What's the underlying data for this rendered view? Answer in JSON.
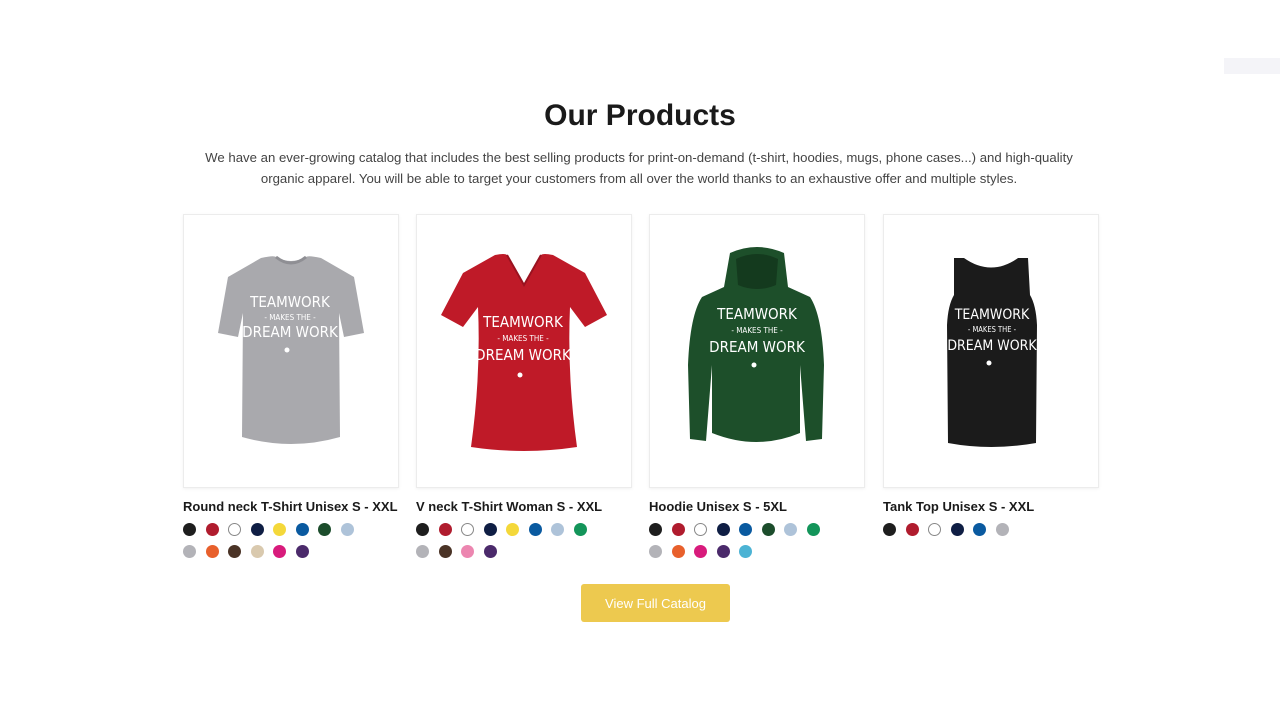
{
  "section": {
    "title": "Our Products",
    "description": "We have an ever-growing catalog that includes the best selling products for print-on-demand (t-shirt, hoodies, mugs, phone cases...) and high-quality organic apparel. You will be able to target your customers from all over the world thanks to an exhaustive offer and multiple styles."
  },
  "print_text": {
    "line1": "TEAMWORK",
    "line2": "- MAKES THE -",
    "line3": "DREAM WORK"
  },
  "products": [
    {
      "name": "Round neck T-Shirt Unisex S - XXL",
      "garment": "tshirt-icon",
      "garment_color": "#a9a9ad",
      "swatches": [
        "#1e1e1e",
        "#b01c2e",
        "#ffffff",
        "#0f1e44",
        "#f4d83a",
        "#0a5aa0",
        "#1c4d2c",
        "#aec3d9",
        "#b3b3b8",
        "#e8602c",
        "#4a3326",
        "#d9c9ae",
        "#d81b7c",
        "#4b2a6b"
      ]
    },
    {
      "name": "V neck T-Shirt Woman S - XXL",
      "garment": "vneck-tshirt-icon",
      "garment_color": "#bf1a28",
      "swatches": [
        "#1e1e1e",
        "#b01c2e",
        "#ffffff",
        "#0f1e44",
        "#f4d83a",
        "#0a5aa0",
        "#aec3d9",
        "#13955a",
        "#b3b3b8",
        "#4a3326",
        "#ec86b0",
        "#4b2a6b"
      ]
    },
    {
      "name": "Hoodie Unisex S - 5XL",
      "garment": "hoodie-icon",
      "garment_color": "#1d4f2a",
      "swatches": [
        "#1e1e1e",
        "#b01c2e",
        "#ffffff",
        "#0f1e44",
        "#0a5aa0",
        "#1c4d2c",
        "#aec3d9",
        "#13955a",
        "#b3b3b8",
        "#e8602c",
        "#d81b7c",
        "#4b2a6b",
        "#4cb3d4"
      ]
    },
    {
      "name": "Tank Top Unisex S - XXL",
      "garment": "tank-top-icon",
      "garment_color": "#1b1b1b",
      "swatches": [
        "#1e1e1e",
        "#b01c2e",
        "#ffffff",
        "#0f1e44",
        "#0a5aa0",
        "#b3b3b8"
      ]
    }
  ],
  "cta": {
    "label": "View Full Catalog",
    "color": "#edc94f"
  }
}
